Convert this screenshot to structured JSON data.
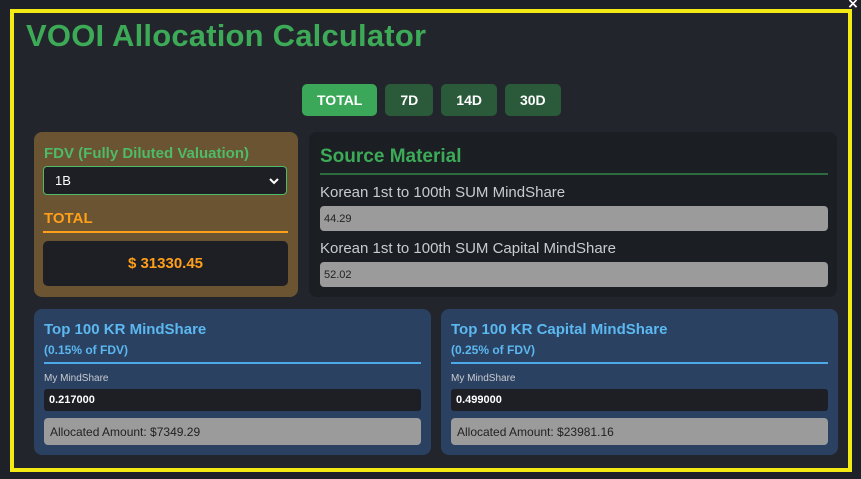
{
  "title": "VOOI Allocation Calculator",
  "close_glyph": "×",
  "tabs": [
    {
      "label": "TOTAL",
      "active": true
    },
    {
      "label": "7D",
      "active": false
    },
    {
      "label": "14D",
      "active": false
    },
    {
      "label": "30D",
      "active": false
    }
  ],
  "fdv": {
    "label": "FDV (Fully Diluted Valuation)",
    "selected": "1B",
    "total_label": "TOTAL",
    "total_value": "$ 31330.45"
  },
  "source": {
    "title": "Source Material",
    "items": [
      {
        "label": "Korean 1st to 100th SUM MindShare",
        "value": "44.29"
      },
      {
        "label": "Korean 1st to 100th SUM Capital MindShare",
        "value": "52.02"
      }
    ]
  },
  "panels": [
    {
      "title": "Top 100 KR MindShare",
      "subtitle": "(0.15% of FDV)",
      "my_label": "My MindShare",
      "my_value": "0.217000",
      "allocated": "Allocated Amount: $7349.29"
    },
    {
      "title": "Top 100 KR Capital MindShare",
      "subtitle": "(0.25% of FDV)",
      "my_label": "My MindShare",
      "my_value": "0.499000",
      "allocated": "Allocated Amount: $23981.16"
    }
  ],
  "colors": {
    "border": "#f5eb14",
    "green": "#3daa57",
    "orange": "#ff9f1a",
    "blue": "#5bb8f0"
  }
}
